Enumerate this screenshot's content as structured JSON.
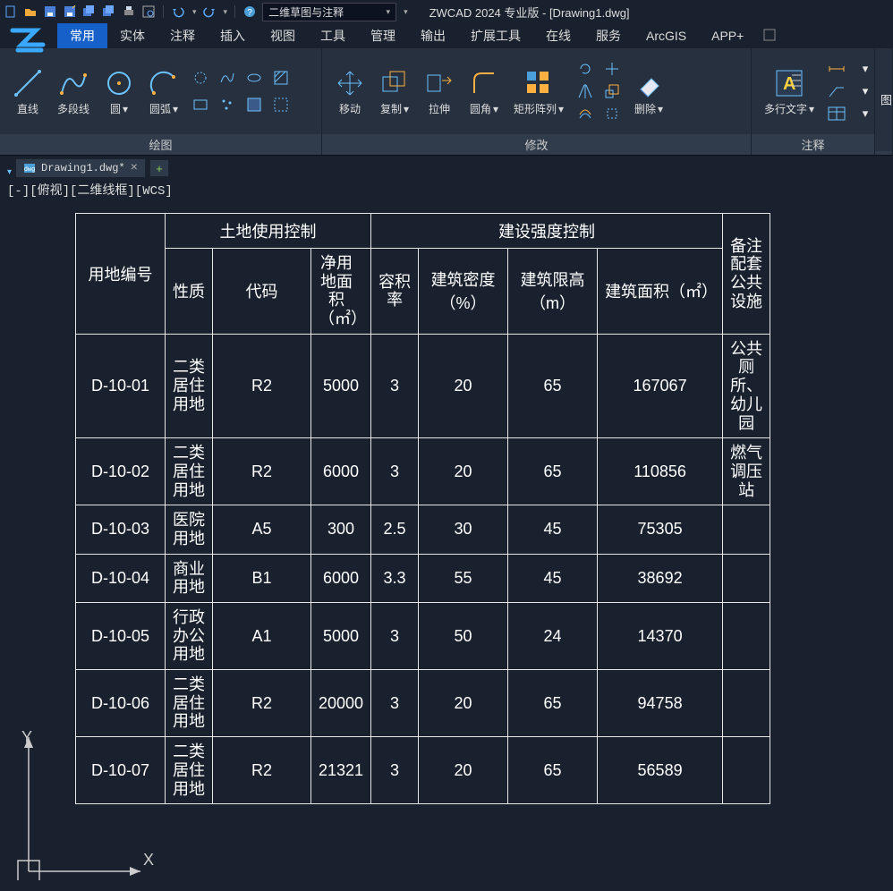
{
  "qat": {
    "workspace": "二维草图与注释",
    "title": "ZWCAD 2024 专业版 - [Drawing1.dwg]"
  },
  "menu": {
    "items": [
      "常用",
      "实体",
      "注释",
      "插入",
      "视图",
      "工具",
      "管理",
      "输出",
      "扩展工具",
      "在线",
      "服务",
      "ArcGIS",
      "APP+"
    ],
    "active": 0
  },
  "ribbon": {
    "draw": {
      "label": "绘图",
      "line": "直线",
      "pline": "多段线",
      "circle": "圆",
      "arc": "圆弧"
    },
    "modify": {
      "label": "修改",
      "move": "移动",
      "copy": "复制",
      "stretch": "拉伸",
      "fillet": "圆角",
      "array": "矩形阵列",
      "erase": "删除"
    },
    "annot": {
      "label": "注释",
      "mtext": "多行文字"
    },
    "extra": "图"
  },
  "doc": {
    "tab": "Drawing1.dwg*",
    "new": "+"
  },
  "viewport": {
    "label": "[-][俯视][二维线框][WCS]",
    "y": "Y",
    "x": "X"
  },
  "table": {
    "h": {
      "col_id": "用地编号",
      "group1": "土地使用控制",
      "group2": "建设强度控制",
      "remark": "备注配套公共设施",
      "nature": "性质",
      "code": "代码",
      "netarea": "净用地面积（㎡）",
      "far": "容积率",
      "density": "建筑密度（%）",
      "height": "建筑限高（m）",
      "barea": "建筑面积（㎡）"
    },
    "rows": [
      {
        "id": "D-10-01",
        "nature": "二类居住用地",
        "code": "R2",
        "netarea": "5000",
        "far": "3",
        "density": "20",
        "height": "65",
        "barea": "167067",
        "remark": "公共厕所、幼儿园"
      },
      {
        "id": "D-10-02",
        "nature": "二类居住用地",
        "code": "R2",
        "netarea": "6000",
        "far": "3",
        "density": "20",
        "height": "65",
        "barea": "110856",
        "remark": "燃气调压站"
      },
      {
        "id": "D-10-03",
        "nature": "医院用地",
        "code": "A5",
        "netarea": "300",
        "far": "2.5",
        "density": "30",
        "height": "45",
        "barea": "75305",
        "remark": ""
      },
      {
        "id": "D-10-04",
        "nature": "商业用地",
        "code": "B1",
        "netarea": "6000",
        "far": "3.3",
        "density": "55",
        "height": "45",
        "barea": "38692",
        "remark": ""
      },
      {
        "id": "D-10-05",
        "nature": "行政办公用地",
        "code": "A1",
        "netarea": "5000",
        "far": "3",
        "density": "50",
        "height": "24",
        "barea": "14370",
        "remark": ""
      },
      {
        "id": "D-10-06",
        "nature": "二类居住用地",
        "code": "R2",
        "netarea": "20000",
        "far": "3",
        "density": "20",
        "height": "65",
        "barea": "94758",
        "remark": ""
      },
      {
        "id": "D-10-07",
        "nature": "二类居住用地",
        "code": "R2",
        "netarea": "21321",
        "far": "3",
        "density": "20",
        "height": "65",
        "barea": "56589",
        "remark": ""
      }
    ]
  }
}
